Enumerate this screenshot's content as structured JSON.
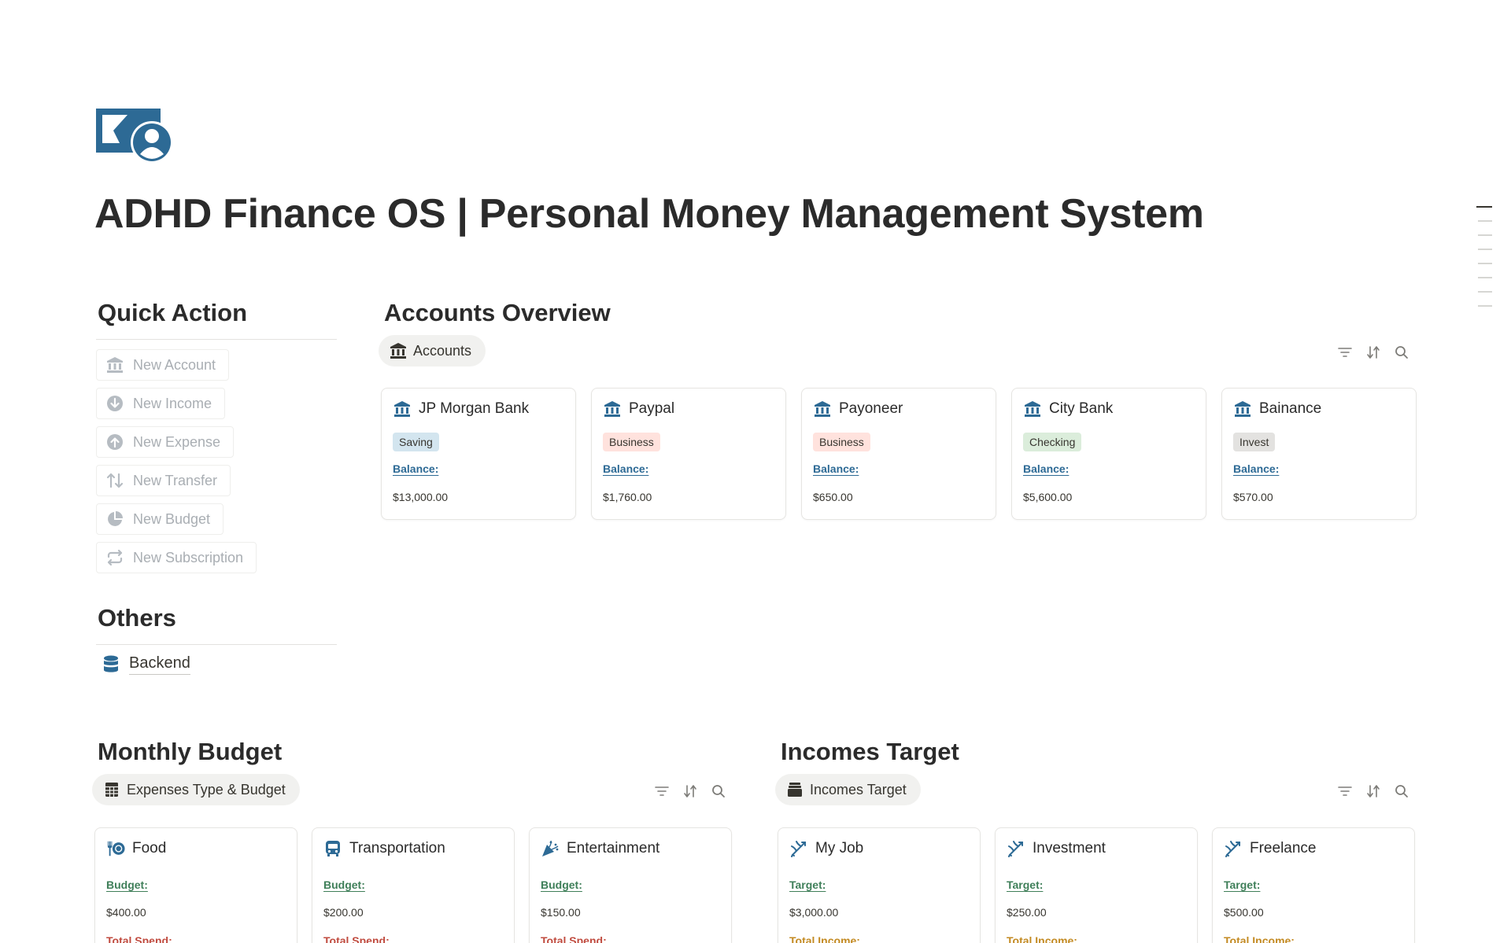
{
  "page": {
    "title": "ADHD Finance OS | Personal Money Management System",
    "icon": "money-bill-icon"
  },
  "colors": {
    "accent_blue": "#2d6a95",
    "tag_blue_bg": "#d3e5ef",
    "tag_red_bg": "#ffe2dd",
    "tag_green_bg": "#dbeddb",
    "tag_gray_bg": "#e3e2e0",
    "label_green": "#3f7f59",
    "label_red": "#c04b3f",
    "label_gold": "#c38a22"
  },
  "quick_action": {
    "heading": "Quick Action",
    "buttons": [
      {
        "label": "New Account",
        "icon": "bank-icon"
      },
      {
        "label": "New Income",
        "icon": "arrow-down-circle-icon"
      },
      {
        "label": "New Expense",
        "icon": "arrow-up-circle-icon"
      },
      {
        "label": "New Transfer",
        "icon": "swap-vertical-icon"
      },
      {
        "label": "New Budget",
        "icon": "pie-chart-icon"
      },
      {
        "label": "New Subscription",
        "icon": "repeat-icon"
      }
    ]
  },
  "others": {
    "heading": "Others",
    "links": [
      {
        "label": "Backend",
        "icon": "database-icon"
      }
    ]
  },
  "accounts_overview": {
    "heading": "Accounts Overview",
    "view_label": "Accounts",
    "cards": [
      {
        "name": "JP Morgan Bank",
        "tag": "Saving",
        "tag_color": "blue",
        "balance_label": "Balance:",
        "balance": "$13,000.00"
      },
      {
        "name": "Paypal",
        "tag": "Business",
        "tag_color": "red",
        "balance_label": "Balance:",
        "balance": "$1,760.00"
      },
      {
        "name": "Payoneer",
        "tag": "Business",
        "tag_color": "red",
        "balance_label": "Balance:",
        "balance": "$650.00"
      },
      {
        "name": "City Bank",
        "tag": "Checking",
        "tag_color": "green",
        "balance_label": "Balance:",
        "balance": "$5,600.00"
      },
      {
        "name": "Bainance",
        "tag": "Invest",
        "tag_color": "gray",
        "balance_label": "Balance:",
        "balance": "$570.00"
      }
    ]
  },
  "monthly_budget": {
    "heading": "Monthly Budget",
    "view_label": "Expenses Type & Budget",
    "cards": [
      {
        "name": "Food",
        "icon": "utensils-icon",
        "budget_label": "Budget:",
        "budget": "$400.00",
        "spend_label": "Total Spend:"
      },
      {
        "name": "Transportation",
        "icon": "bus-icon",
        "budget_label": "Budget:",
        "budget": "$200.00",
        "spend_label": "Total Spend:"
      },
      {
        "name": "Entertainment",
        "icon": "party-popper-icon",
        "budget_label": "Budget:",
        "budget": "$150.00",
        "spend_label": "Total Spend:"
      }
    ]
  },
  "incomes_target": {
    "heading": "Incomes Target",
    "view_label": "Incomes Target",
    "cards": [
      {
        "name": "My Job",
        "icon": "target-arrow-icon",
        "target_label": "Target:",
        "target": "$3,000.00",
        "income_label": "Total Income:"
      },
      {
        "name": "Investment",
        "icon": "target-arrow-icon",
        "target_label": "Target:",
        "target": "$250.00",
        "income_label": "Total Income:"
      },
      {
        "name": "Freelance",
        "icon": "target-arrow-icon",
        "target_label": "Target:",
        "target": "$500.00",
        "income_label": "Total Income:"
      }
    ]
  }
}
